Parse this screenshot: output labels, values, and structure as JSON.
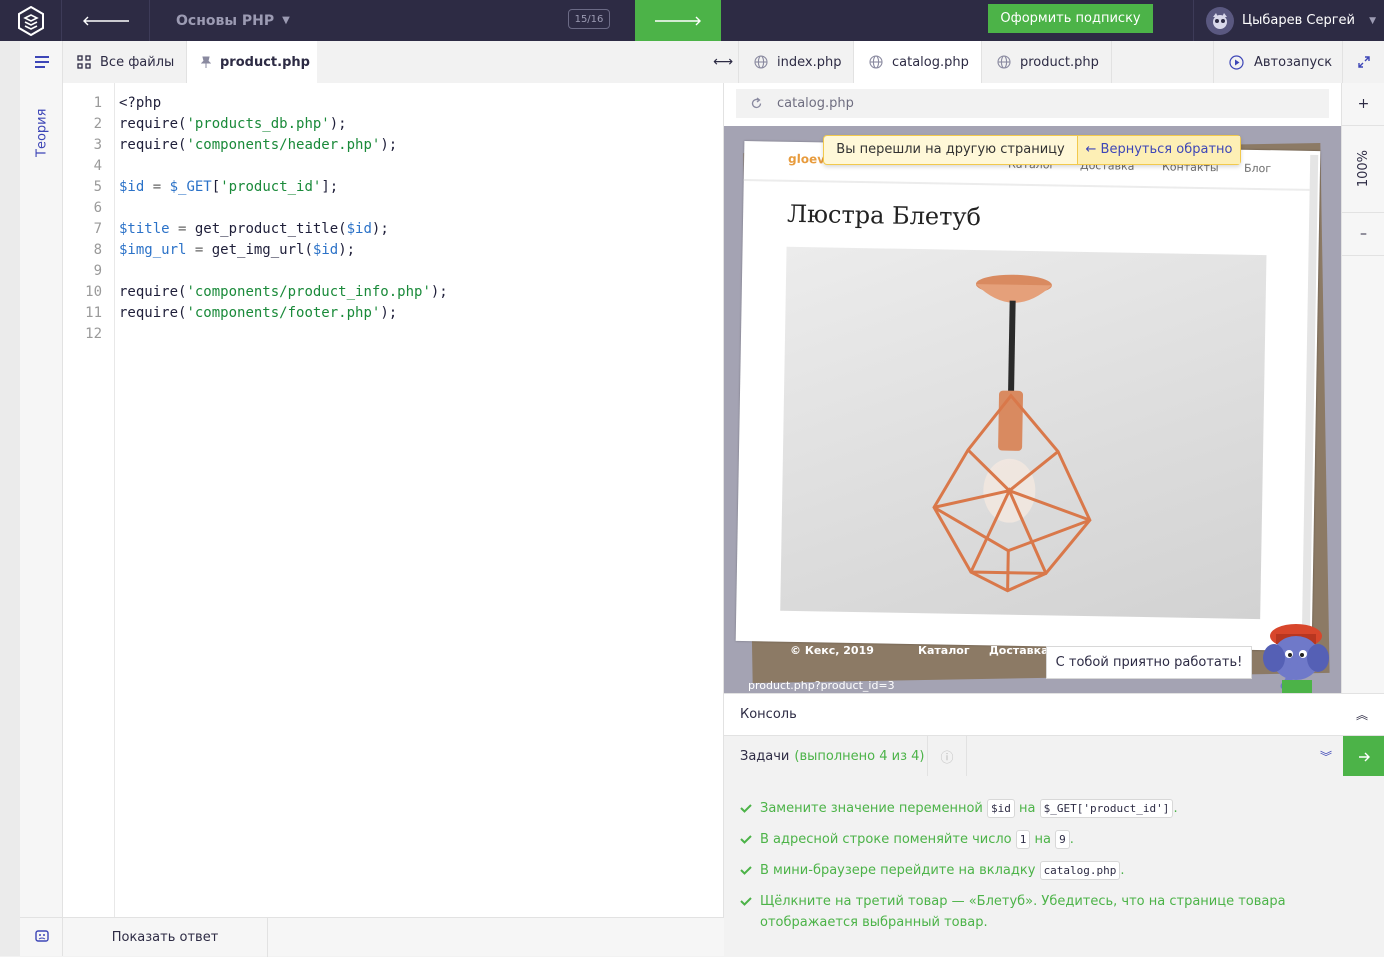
{
  "header": {
    "course_title": "Основы PHP",
    "progress": "15/16",
    "subscribe_label": "Оформить подписку",
    "user_name": "Цыбарев Сергей"
  },
  "sidebar": {
    "theory_label": "Теория"
  },
  "editor": {
    "tabs": [
      {
        "label": "Все файлы"
      },
      {
        "label": "product.php"
      }
    ],
    "line_numbers": [
      "1",
      "2",
      "3",
      "4",
      "5",
      "6",
      "7",
      "8",
      "9",
      "10",
      "11",
      "12"
    ],
    "show_answer_label": "Показать ответ",
    "code_lines": [
      [
        {
          "t": "<?php",
          "k": "plain"
        }
      ],
      [
        {
          "t": "require(",
          "k": "plain"
        },
        {
          "t": "'products_db.php'",
          "k": "str"
        },
        {
          "t": ");",
          "k": "plain"
        }
      ],
      [
        {
          "t": "require(",
          "k": "plain"
        },
        {
          "t": "'components/header.php'",
          "k": "str"
        },
        {
          "t": ");",
          "k": "plain"
        }
      ],
      [],
      [
        {
          "t": "$id",
          "k": "var"
        },
        {
          "t": " = ",
          "k": "op"
        },
        {
          "t": "$_GET",
          "k": "var"
        },
        {
          "t": "[",
          "k": "plain"
        },
        {
          "t": "'product_id'",
          "k": "str"
        },
        {
          "t": "];",
          "k": "plain"
        }
      ],
      [],
      [
        {
          "t": "$title",
          "k": "var"
        },
        {
          "t": " = ",
          "k": "op"
        },
        {
          "t": "get_product_title(",
          "k": "plain"
        },
        {
          "t": "$id",
          "k": "var"
        },
        {
          "t": ");",
          "k": "plain"
        }
      ],
      [
        {
          "t": "$img_url",
          "k": "var"
        },
        {
          "t": " = ",
          "k": "op"
        },
        {
          "t": "get_img_url(",
          "k": "plain"
        },
        {
          "t": "$id",
          "k": "var"
        },
        {
          "t": ");",
          "k": "plain"
        }
      ],
      [],
      [
        {
          "t": "require(",
          "k": "plain"
        },
        {
          "t": "'components/product_info.php'",
          "k": "str"
        },
        {
          "t": ");",
          "k": "plain"
        }
      ],
      [
        {
          "t": "require(",
          "k": "plain"
        },
        {
          "t": "'components/footer.php'",
          "k": "str"
        },
        {
          "t": ");",
          "k": "plain"
        }
      ],
      []
    ]
  },
  "browser": {
    "tabs": [
      {
        "label": "index.php"
      },
      {
        "label": "catalog.php"
      },
      {
        "label": "product.php"
      }
    ],
    "autorun_label": "Автозапуск",
    "url": "catalog.php",
    "zoom": "100%",
    "zoom_plus": "+",
    "zoom_minus": "–",
    "notice_message": "Вы перешли на другую страницу",
    "notice_return": "← Вернуться обратно",
    "mini_site": {
      "logo": "gloevk",
      "nav": [
        "Каталог",
        "Доставка",
        "Контакты",
        "Блог"
      ],
      "product_title": "Люстра Блетуб",
      "footer_copy": "© Кекс, 2019",
      "footer_nav": [
        "Каталог",
        "Доставка"
      ]
    },
    "status_url": "product.php?product_id=3",
    "mascot_message": "С тобой приятно работать!"
  },
  "console": {
    "label": "Консоль"
  },
  "tasks": {
    "label": "Задачи",
    "done_label": "(выполнено 4 из 4)",
    "items": [
      {
        "parts": [
          {
            "t": "Замените значение переменной ",
            "chip": false
          },
          {
            "t": "$id",
            "chip": true
          },
          {
            "t": " на ",
            "chip": false
          },
          {
            "t": "$_GET['product_id']",
            "chip": true
          },
          {
            "t": ".",
            "chip": false
          }
        ]
      },
      {
        "parts": [
          {
            "t": "В адресной строке поменяйте число ",
            "chip": false
          },
          {
            "t": "1",
            "chip": true
          },
          {
            "t": " на ",
            "chip": false
          },
          {
            "t": "9",
            "chip": true
          },
          {
            "t": ".",
            "chip": false
          }
        ]
      },
      {
        "parts": [
          {
            "t": "В мини-браузере перейдите на вкладку ",
            "chip": false
          },
          {
            "t": "catalog.php",
            "chip": true
          },
          {
            "t": ".",
            "chip": false
          }
        ]
      },
      {
        "parts": [
          {
            "t": "Щёлкните на третий товар — «Блетуб». Убедитесь, что на странице товара отображается выбранный товар.",
            "chip": false
          }
        ]
      }
    ]
  },
  "colors": {
    "header_bg": "#2d2b44",
    "accent_green": "#4cb348",
    "accent_blue": "#3d46b7",
    "string_green": "#1a8a3a",
    "variable_blue": "#2b72c8"
  },
  "icons": [
    "logo-icon",
    "arrow-left-icon",
    "arrow-right-icon",
    "chevron-down-icon",
    "avatar-icon",
    "hamburger-icon",
    "grid-icon",
    "pin-icon",
    "resize-icon",
    "globe-icon",
    "play-icon",
    "expand-icon",
    "reload-icon",
    "feedback-icon",
    "info-icon",
    "double-chevron-up-icon",
    "double-chevron-down-icon",
    "check-icon"
  ]
}
